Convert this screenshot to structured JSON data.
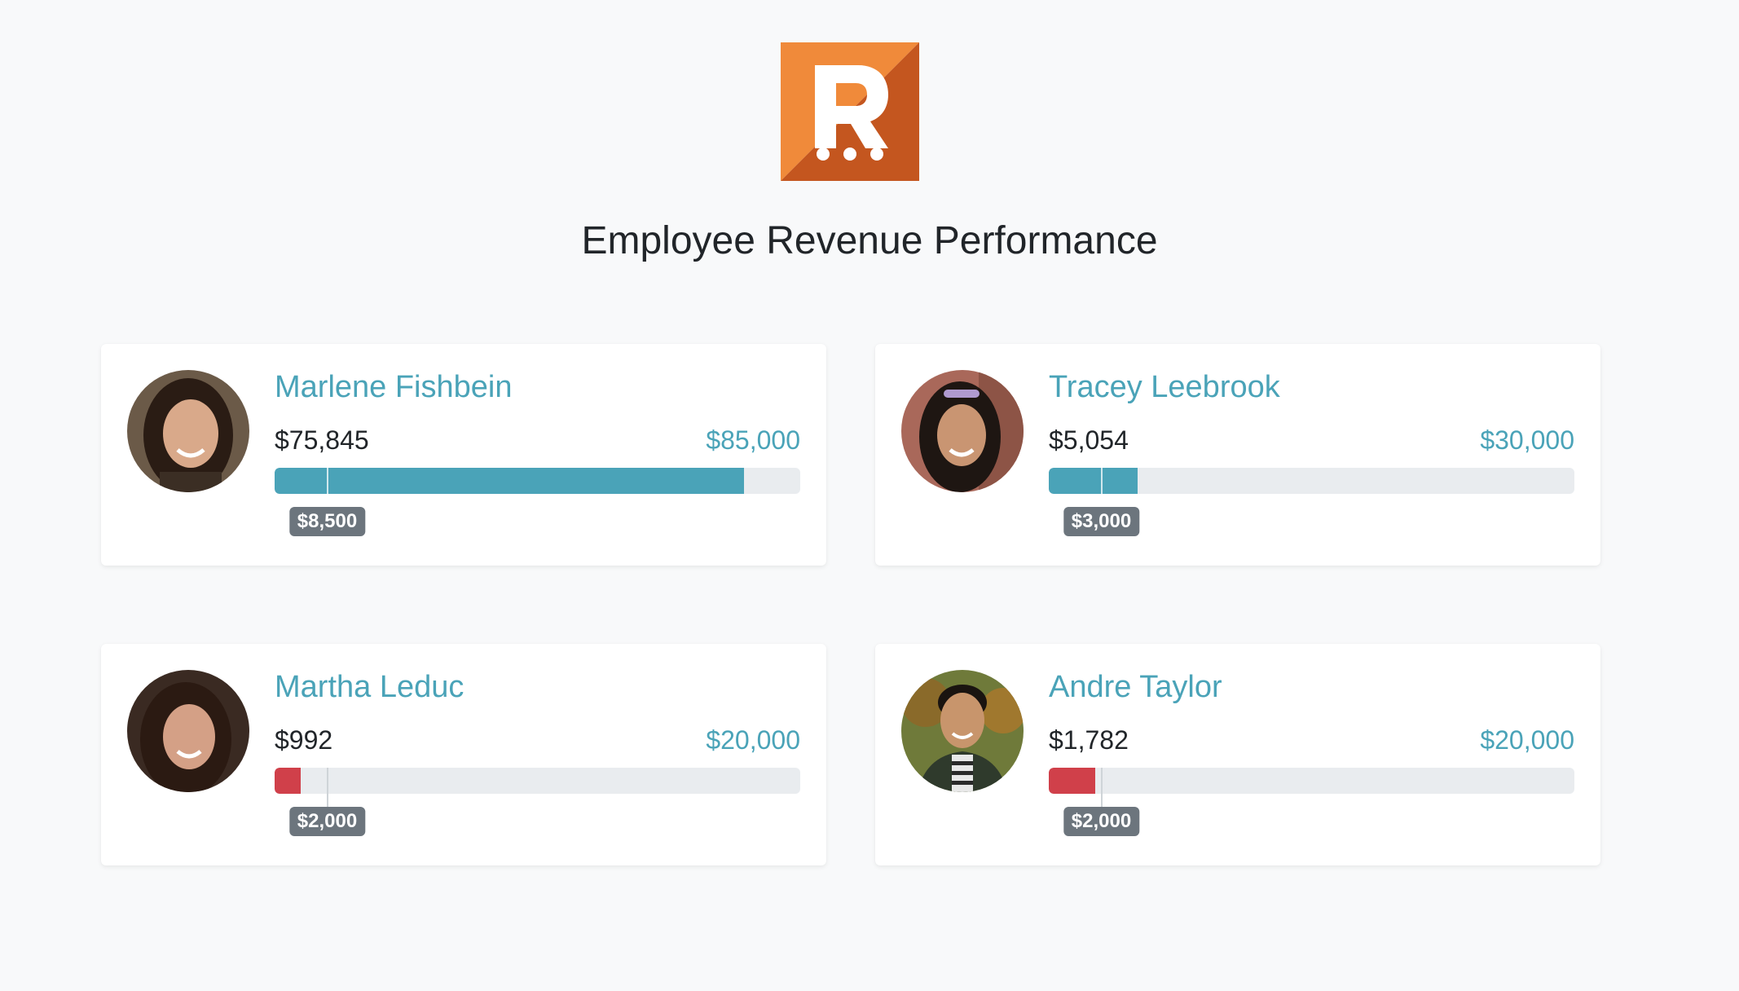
{
  "page": {
    "title": "Employee Revenue Performance"
  },
  "logo": {
    "icon": "r-logo-icon",
    "letter": "R",
    "colors": {
      "light": "#f08a3a",
      "dark": "#c4561f",
      "glyph": "#ffffff"
    }
  },
  "colors": {
    "accent": "#4aa3b8",
    "danger": "#d0404a",
    "badge": "#6c757d",
    "track": "#e9ecef"
  },
  "employees": [
    {
      "name": "Marlene Fishbein",
      "current": "$75,845",
      "target": "$85,000",
      "marker": "$8,500",
      "progress": 0.8923,
      "marker_fraction": 0.1,
      "status": "good",
      "avatar": "avatar-photo",
      "avatar_colors": {
        "bg": "#6b5a48",
        "hair": "#2a1c14",
        "skin": "#d9a98a"
      }
    },
    {
      "name": "Tracey Leebrook",
      "current": "$5,054",
      "target": "$30,000",
      "marker": "$3,000",
      "progress": 0.1685,
      "marker_fraction": 0.1,
      "status": "good",
      "avatar": "avatar-photo",
      "avatar_colors": {
        "bg": "#a9685a",
        "hair": "#1e1612",
        "skin": "#c99572"
      }
    },
    {
      "name": "Martha Leduc",
      "current": "$992",
      "target": "$20,000",
      "marker": "$2,000",
      "progress": 0.0496,
      "marker_fraction": 0.1,
      "status": "bad",
      "avatar": "avatar-photo",
      "avatar_colors": {
        "bg": "#3a2a22",
        "hair": "#2b1a12",
        "skin": "#d4a086"
      }
    },
    {
      "name": "Andre Taylor",
      "current": "$1,782",
      "target": "$20,000",
      "marker": "$2,000",
      "progress": 0.0891,
      "marker_fraction": 0.1,
      "status": "bad",
      "avatar": "avatar-photo",
      "avatar_colors": {
        "bg": "#6f7a3a",
        "hair": "#1a1410",
        "skin": "#c8956c"
      }
    }
  ]
}
